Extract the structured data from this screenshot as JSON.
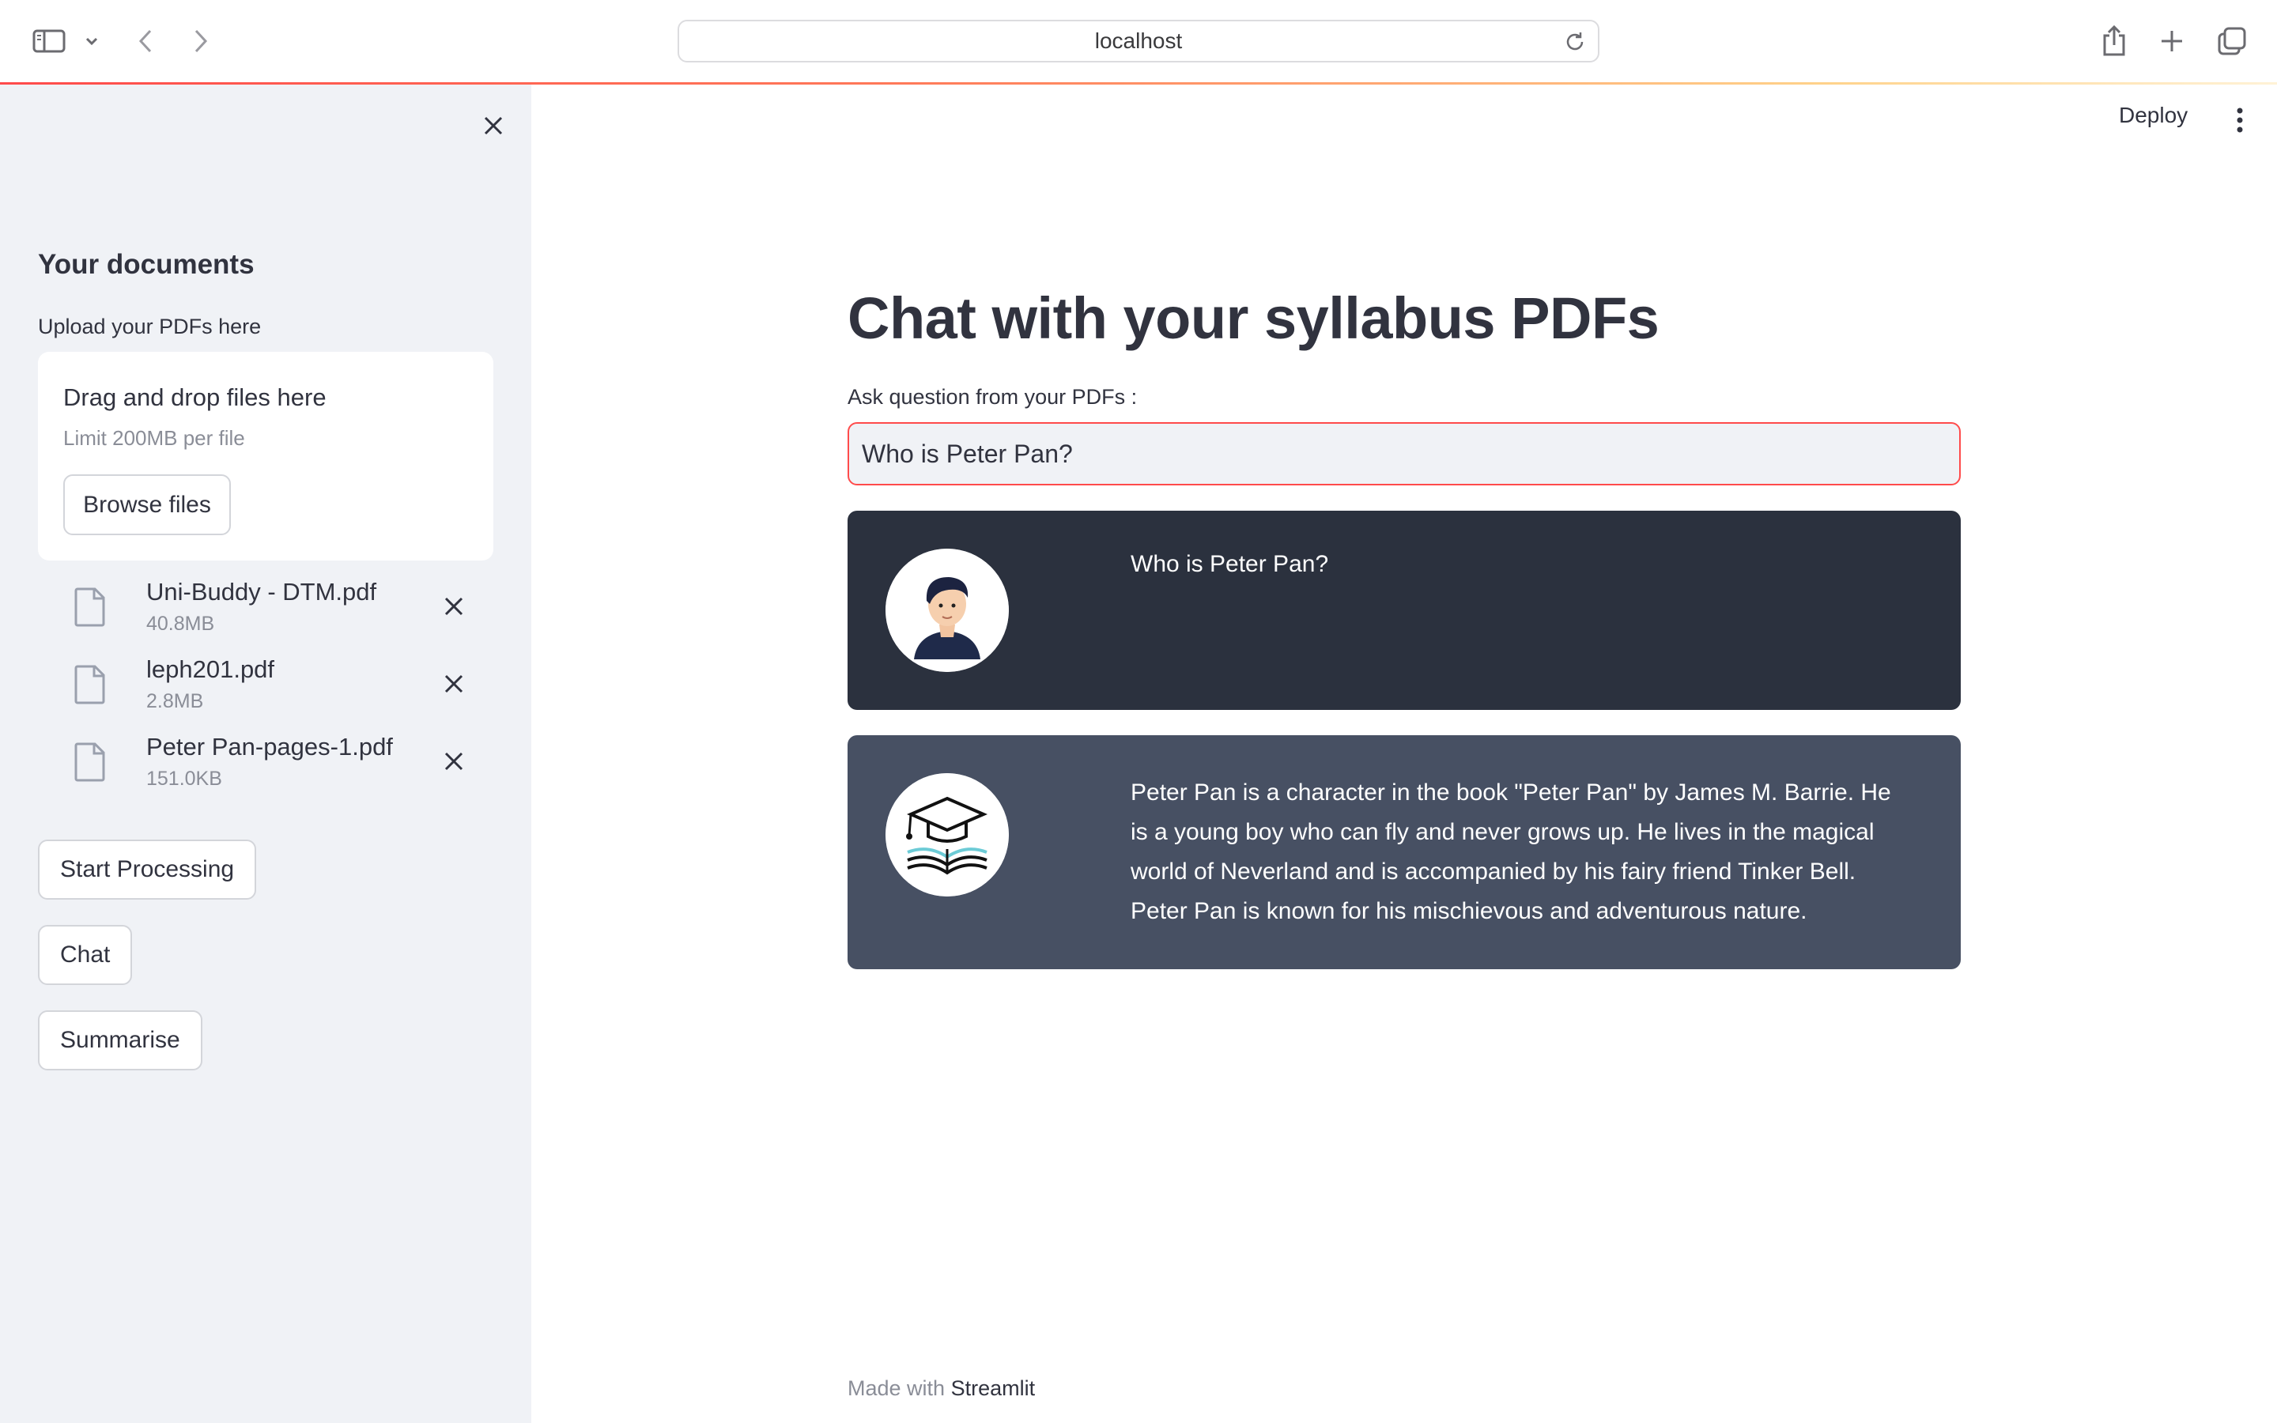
{
  "browser": {
    "url": "localhost"
  },
  "sidebar": {
    "heading": "Your documents",
    "upload_label": "Upload your PDFs here",
    "dropzone": {
      "title": "Drag and drop files here",
      "limit": "Limit 200MB per file",
      "browse_label": "Browse files"
    },
    "files": [
      {
        "name": "Uni-Buddy - DTM.pdf",
        "size": "40.8MB"
      },
      {
        "name": "leph201.pdf",
        "size": "2.8MB"
      },
      {
        "name": "Peter Pan-pages-1.pdf",
        "size": "151.0KB"
      }
    ],
    "buttons": {
      "start_processing": "Start Processing",
      "chat": "Chat",
      "summarise": "Summarise"
    }
  },
  "header": {
    "deploy_label": "Deploy"
  },
  "main": {
    "title": "Chat with your syllabus PDFs",
    "question_label": "Ask question from your PDFs :",
    "question_value": "Who is Peter Pan?",
    "messages": [
      {
        "role": "user",
        "text": "Who is Peter Pan?"
      },
      {
        "role": "bot",
        "text": "Peter Pan is a character in the book \"Peter Pan\" by James M. Barrie. He is a young boy who can fly and never grows up. He lives in the magical world of Neverland and is accompanied by his fairy friend Tinker Bell. Peter Pan is known for his mischievous and adventurous nature."
      }
    ]
  },
  "footer": {
    "prefix": "Made with",
    "link": "Streamlit"
  },
  "colors": {
    "accent": "#ff4b4b",
    "sidebar_bg": "#f0f2f6",
    "user_msg_bg": "#2b313e",
    "bot_msg_bg": "#475063"
  },
  "icons": [
    "sidebar-toggle-icon",
    "chevron-down-icon",
    "back-icon",
    "forward-icon",
    "reload-icon",
    "share-icon",
    "new-tab-icon",
    "tabs-overview-icon",
    "close-icon",
    "file-icon",
    "kebab-menu-icon",
    "user-avatar-icon",
    "graduation-book-avatar-icon"
  ]
}
